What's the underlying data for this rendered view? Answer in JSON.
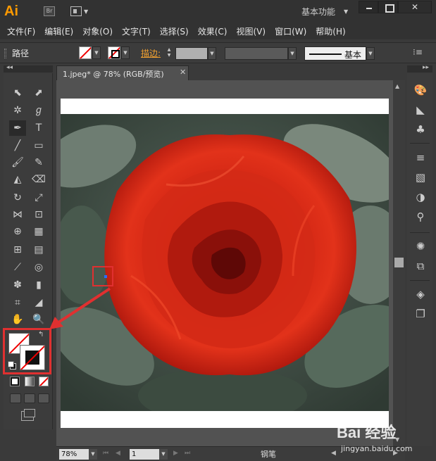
{
  "app": {
    "logo": "Ai",
    "bridge_label": "Br",
    "workspace": "基本功能"
  },
  "menu": [
    "文件(F)",
    "编辑(E)",
    "对象(O)",
    "文字(T)",
    "选择(S)",
    "效果(C)",
    "视图(V)",
    "窗口(W)",
    "帮助(H)"
  ],
  "control_bar": {
    "selection_type": "路径",
    "stroke_label": "描边:",
    "brush_label": "基本"
  },
  "document": {
    "tab_title": "1.jpeg* @ 78% (RGB/预览)",
    "zoom": "78%",
    "page": "1",
    "current_tool": "钢笔"
  },
  "colors": {
    "accent_highlight": "#e03030",
    "stroke_label": "#f0a030",
    "anchor": "#2a6cff",
    "logo": "#ff9a00"
  },
  "tools": [
    "selection-tool",
    "direct-selection-tool",
    "magic-wand-tool",
    "lasso-tool",
    "pen-tool",
    "type-tool",
    "line-tool",
    "rectangle-tool",
    "paintbrush-tool",
    "pencil-tool",
    "blob-brush-tool",
    "eraser-tool",
    "rotate-tool",
    "scale-tool",
    "width-tool",
    "free-transform-tool",
    "shape-builder-tool",
    "perspective-grid-tool",
    "mesh-tool",
    "gradient-tool",
    "eyedropper-tool",
    "blend-tool",
    "symbol-sprayer-tool",
    "column-graph-tool",
    "artboard-tool",
    "slice-tool",
    "hand-tool",
    "zoom-tool"
  ],
  "panels": [
    "color-guide-icon",
    "gradient-panel-icon",
    "symbols-icon",
    "stroke-panel-icon",
    "transparency-icon",
    "appearance-icon",
    "brushes-icon",
    "graphic-styles-icon",
    "transform-icon",
    "layers-icon",
    "artboards-icon"
  ],
  "watermark": {
    "brand": "Bai 经验",
    "url": "jingyan.baidu.com"
  }
}
